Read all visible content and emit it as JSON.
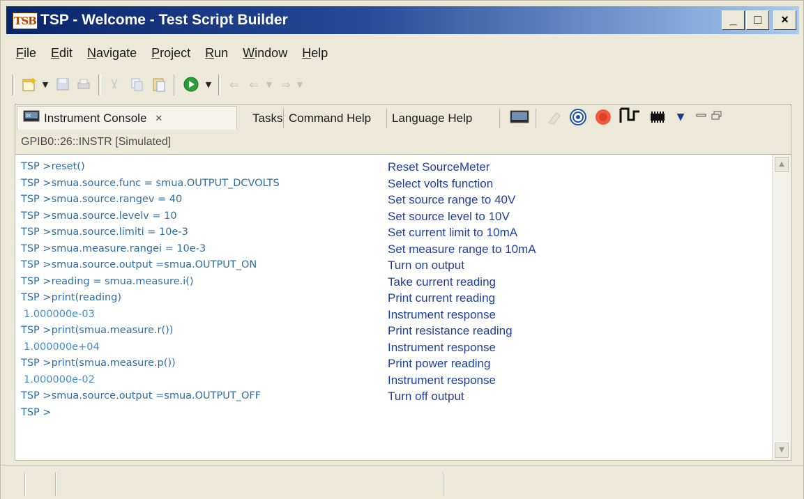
{
  "window": {
    "title": "TSP - Welcome - Test Script Builder",
    "app_icon_text": "TSB",
    "controls": {
      "minimize": "_",
      "maximize": "□",
      "close": "×"
    }
  },
  "menu": [
    "File",
    "Edit",
    "Navigate",
    "Project",
    "Run",
    "Window",
    "Help"
  ],
  "toolbar": {
    "icons": [
      "new-icon",
      "save-icon",
      "print-icon",
      "cut-icon",
      "copy-icon",
      "paste-icon",
      "run-icon",
      "back-icon",
      "forward-icon"
    ]
  },
  "tabs": {
    "active": "Instrument Console",
    "active_close": "✕",
    "others": [
      "Tasks",
      "Command Help",
      "Language Help"
    ]
  },
  "instrument": "GPIB0::26::INSTR [Simulated]",
  "console": {
    "lines": [
      {
        "text": "TSP >reset()",
        "type": "cmd",
        "comment": "Reset SourceMeter"
      },
      {
        "text": "TSP >smua.source.func = smua.OUTPUT_DCVOLTS",
        "type": "cmd",
        "comment": "Select volts function"
      },
      {
        "text": "TSP >smua.source.rangev = 40",
        "type": "cmd",
        "comment": "Set source range to 40V"
      },
      {
        "text": "TSP >smua.source.levelv = 10",
        "type": "cmd",
        "comment": "Set source level to 10V"
      },
      {
        "text": "TSP >smua.source.limiti = 10e-3",
        "type": "cmd",
        "comment": "Set current limit to 10mA"
      },
      {
        "text": "TSP >smua.measure.rangei = 10e-3",
        "type": "cmd",
        "comment": "Set measure range to 10mA"
      },
      {
        "text": "TSP >smua.source.output =smua.OUTPUT_ON",
        "type": "cmd",
        "comment": "Turn on output"
      },
      {
        "text": "TSP >reading = smua.measure.i()",
        "type": "cmd",
        "comment": "Take current reading"
      },
      {
        "text": "TSP >print(reading)",
        "type": "cmd",
        "comment": "Print current reading"
      },
      {
        "text": "1.000000e-03",
        "type": "resp",
        "comment": "Instrument response"
      },
      {
        "text": "TSP >print(smua.measure.r())",
        "type": "cmd",
        "comment": "Print resistance reading"
      },
      {
        "text": "1.000000e+04",
        "type": "resp",
        "comment": "Instrument response"
      },
      {
        "text": "TSP >print(smua.measure.p())",
        "type": "cmd",
        "comment": "Print power reading"
      },
      {
        "text": "1.000000e-02",
        "type": "resp",
        "comment": "Instrument response"
      },
      {
        "text": "TSP >smua.source.output =smua.OUTPUT_OFF",
        "type": "cmd",
        "comment": "Turn off output"
      },
      {
        "text": "TSP >",
        "type": "cmd",
        "comment": ""
      }
    ]
  },
  "colors": {
    "title_gradient_start": "#0a246a",
    "title_gradient_end": "#a6caf0",
    "console_command": "#2e6ea6",
    "console_response": "#3f8fd6",
    "annotation": "#1f3fa0"
  }
}
